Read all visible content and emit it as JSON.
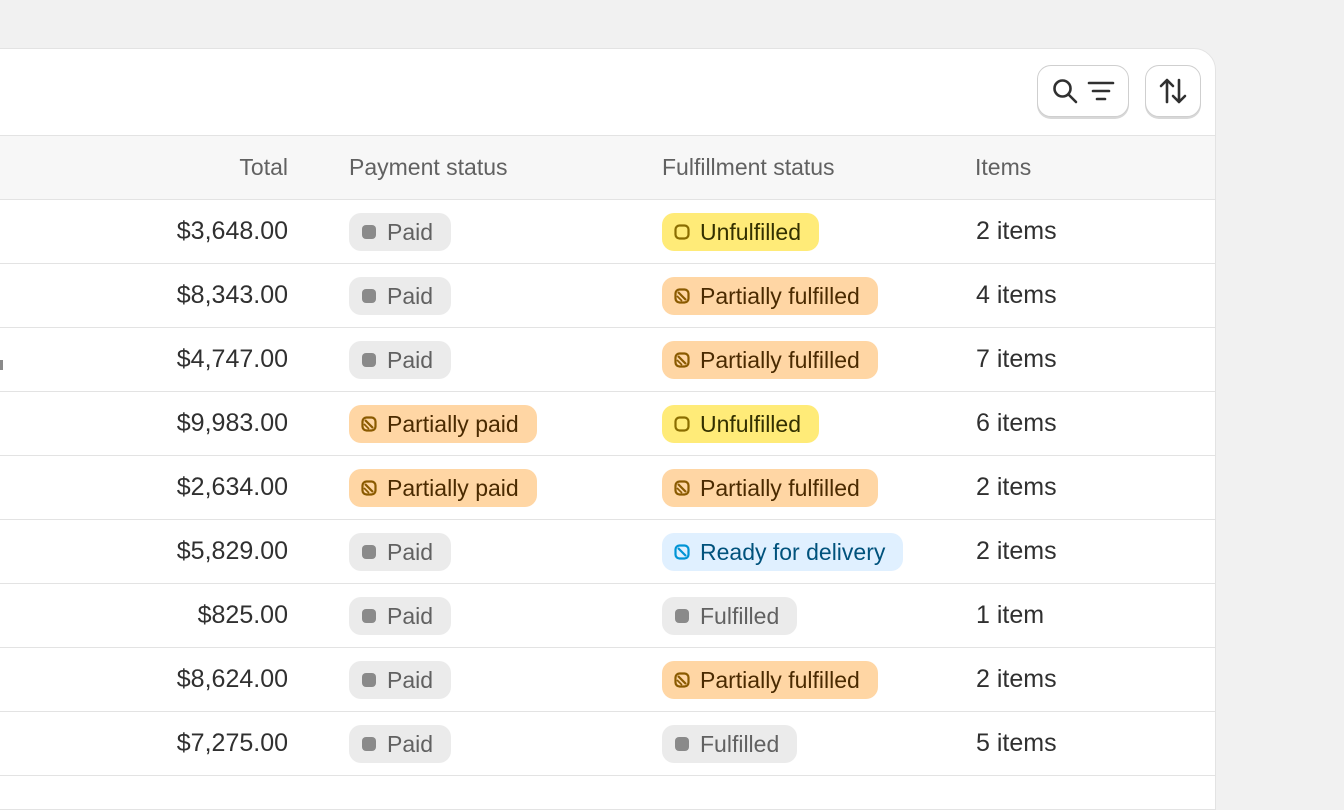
{
  "toolbar": {
    "search_filter_icon": "search-filter-icon",
    "sort_icon": "sort-icon"
  },
  "table": {
    "columns": {
      "total": "Total",
      "payment": "Payment status",
      "fulfillment": "Fulfillment status",
      "items": "Items"
    },
    "rows": [
      {
        "total": "$3,648.00",
        "payment": "Paid",
        "payment_tone": "gray",
        "fulfillment": "Unfulfilled",
        "fulfillment_tone": "yellow",
        "items": "2 items"
      },
      {
        "total": "$8,343.00",
        "payment": "Paid",
        "payment_tone": "gray",
        "fulfillment": "Partially fulfilled",
        "fulfillment_tone": "orange",
        "items": "4 items"
      },
      {
        "total": "$4,747.00",
        "payment": "Paid",
        "payment_tone": "gray",
        "fulfillment": "Partially fulfilled",
        "fulfillment_tone": "orange",
        "items": "7 items"
      },
      {
        "total": "$9,983.00",
        "payment": "Partially paid",
        "payment_tone": "orange",
        "fulfillment": "Unfulfilled",
        "fulfillment_tone": "yellow",
        "items": "6 items"
      },
      {
        "total": "$2,634.00",
        "payment": "Partially paid",
        "payment_tone": "orange",
        "fulfillment": "Partially fulfilled",
        "fulfillment_tone": "orange",
        "items": "2 items"
      },
      {
        "total": "$5,829.00",
        "payment": "Paid",
        "payment_tone": "gray",
        "fulfillment": "Ready for delivery",
        "fulfillment_tone": "blue",
        "items": "2 items"
      },
      {
        "total": "$825.00",
        "payment": "Paid",
        "payment_tone": "gray",
        "fulfillment": "Fulfilled",
        "fulfillment_tone": "gray",
        "items": "1 item"
      },
      {
        "total": "$8,624.00",
        "payment": "Paid",
        "payment_tone": "gray",
        "fulfillment": "Partially fulfilled",
        "fulfillment_tone": "orange",
        "items": "2 items"
      },
      {
        "total": "$7,275.00",
        "payment": "Paid",
        "payment_tone": "gray",
        "fulfillment": "Fulfilled",
        "fulfillment_tone": "gray",
        "items": "5 items"
      }
    ]
  },
  "colors": {
    "gray_dot": "#8a8a8a",
    "yellow_icon": "#8a6d00",
    "orange_icon": "#8a5a00",
    "blue_icon": "#0094d5"
  }
}
